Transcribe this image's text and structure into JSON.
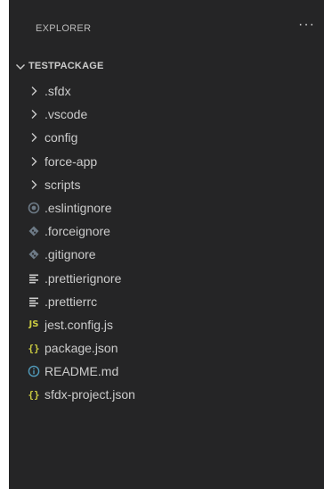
{
  "header": {
    "title": "EXPLORER",
    "more_actions": "···"
  },
  "root": {
    "label": "TESTPACKAGE",
    "expanded": true
  },
  "items": [
    {
      "label": ".sfdx",
      "type": "folder",
      "icon": "chevron-right-icon"
    },
    {
      "label": ".vscode",
      "type": "folder",
      "icon": "chevron-right-icon"
    },
    {
      "label": "config",
      "type": "folder",
      "icon": "chevron-right-icon"
    },
    {
      "label": "force-app",
      "type": "folder",
      "icon": "chevron-right-icon"
    },
    {
      "label": "scripts",
      "type": "folder",
      "icon": "chevron-right-icon"
    },
    {
      "label": ".eslintignore",
      "type": "file",
      "icon": "eslint-icon"
    },
    {
      "label": ".forceignore",
      "type": "file",
      "icon": "diamond-icon"
    },
    {
      "label": ".gitignore",
      "type": "file",
      "icon": "diamond-icon"
    },
    {
      "label": ".prettierignore",
      "type": "file",
      "icon": "lines-icon"
    },
    {
      "label": ".prettierrc",
      "type": "file",
      "icon": "lines-icon"
    },
    {
      "label": "jest.config.js",
      "type": "file",
      "icon": "js-icon",
      "badge": "JS"
    },
    {
      "label": "package.json",
      "type": "file",
      "icon": "json-braces-icon",
      "badge": "{}"
    },
    {
      "label": "README.md",
      "type": "file",
      "icon": "info-icon"
    },
    {
      "label": "sfdx-project.json",
      "type": "file",
      "icon": "json-braces-icon",
      "badge": "{}"
    }
  ],
  "colors": {
    "background": "#252526",
    "text": "#cccccc",
    "icon_muted": "#6d7a86",
    "json_yellow": "#cbcb41",
    "info_blue": "#519aba"
  }
}
